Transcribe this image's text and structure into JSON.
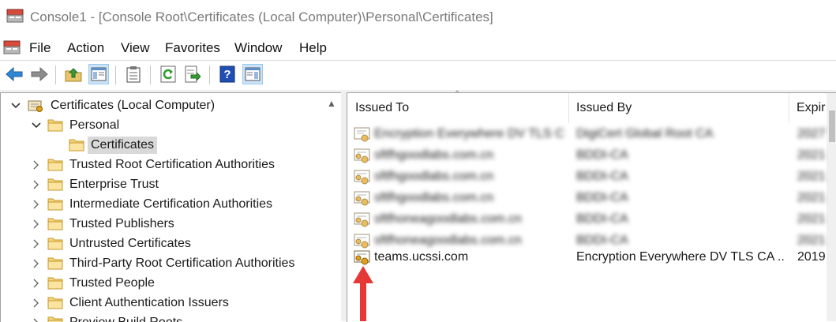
{
  "window": {
    "title": "Console1 - [Console Root\\Certificates (Local Computer)\\Personal\\Certificates]"
  },
  "menu": {
    "items": [
      "File",
      "Action",
      "View",
      "Favorites",
      "Window",
      "Help"
    ]
  },
  "toolbar": {
    "buttons": [
      "back-arrow-icon",
      "forward-arrow-icon",
      "up-folder-icon",
      "show-hide-tree-icon",
      "clipboard-icon",
      "refresh-icon",
      "export-list-icon",
      "help-icon",
      "show-action-pane-icon"
    ]
  },
  "tree": {
    "root": "Certificates (Local Computer)",
    "personal": "Personal",
    "certificates": "Certificates",
    "items": [
      "Trusted Root Certification Authorities",
      "Enterprise Trust",
      "Intermediate Certification Authorities",
      "Trusted Publishers",
      "Untrusted Certificates",
      "Third-Party Root Certification Authorities",
      "Trusted People",
      "Client Authentication Issuers",
      "Preview Build Roots"
    ]
  },
  "list": {
    "columns": {
      "issued_to": "Issued To",
      "issued_by": "Issued By",
      "expiration": "Expir"
    },
    "rows": [
      {
        "issued_to": "Encryption Everywhere DV TLS C...",
        "issued_by": "DigiCert Global Root CA",
        "expiration": "2027",
        "blurred": true
      },
      {
        "issued_to": "sftfhgoodlabs.com.cn",
        "issued_by": "BDDI-CA",
        "expiration": "2021",
        "blurred": true
      },
      {
        "issued_to": "sftfhgoodlabs.com.cn",
        "issued_by": "BDDI-CA",
        "expiration": "2021",
        "blurred": true
      },
      {
        "issued_to": "sftfhgoodlabs.com.cn",
        "issued_by": "BDDI-CA",
        "expiration": "2021",
        "blurred": true
      },
      {
        "issued_to": "sftfhoneagoodlabs.com.cn",
        "issued_by": "BDDI-CA",
        "expiration": "2021",
        "blurred": true
      },
      {
        "issued_to": "sftfhoneagoodlabs.com.cn",
        "issued_by": "BDDI-CA",
        "expiration": "2021",
        "blurred": true
      },
      {
        "issued_to": "teams.ucssi.com",
        "issued_by": "Encryption Everywhere DV TLS CA ...",
        "expiration": "2019",
        "blurred": false
      }
    ]
  },
  "colors": {
    "annotation_arrow": "#e53935",
    "selection": "#d9d9d9",
    "folder": "#f4c95d"
  }
}
